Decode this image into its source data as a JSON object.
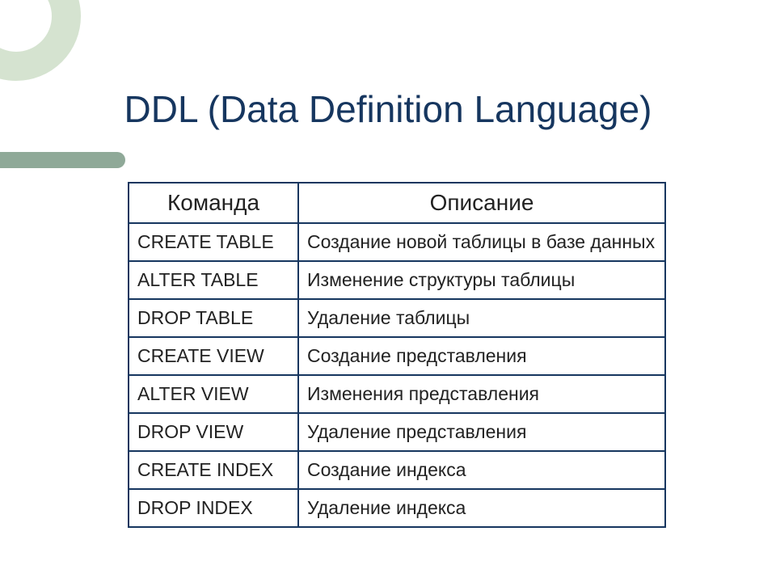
{
  "title": "DDL (Data Definition Language)",
  "table": {
    "headers": {
      "command": "Команда",
      "description": "Описание"
    },
    "rows": [
      {
        "command": "CREATE TABLE",
        "description": "Создание новой таблицы в базе данных"
      },
      {
        "command": "ALTER TABLE",
        "description": "Изменение структуры таблицы"
      },
      {
        "command": "DROP TABLE",
        "description": "Удаление таблицы"
      },
      {
        "command": "CREATE VIEW",
        "description": "Создание представления"
      },
      {
        "command": "ALTER VIEW",
        "description": "Изменения представления"
      },
      {
        "command": "DROP VIEW",
        "description": "Удаление представления"
      },
      {
        "command": "CREATE INDEX",
        "description": "Создание индекса"
      },
      {
        "command": "DROP INDEX",
        "description": "Удаление индекса"
      }
    ]
  }
}
